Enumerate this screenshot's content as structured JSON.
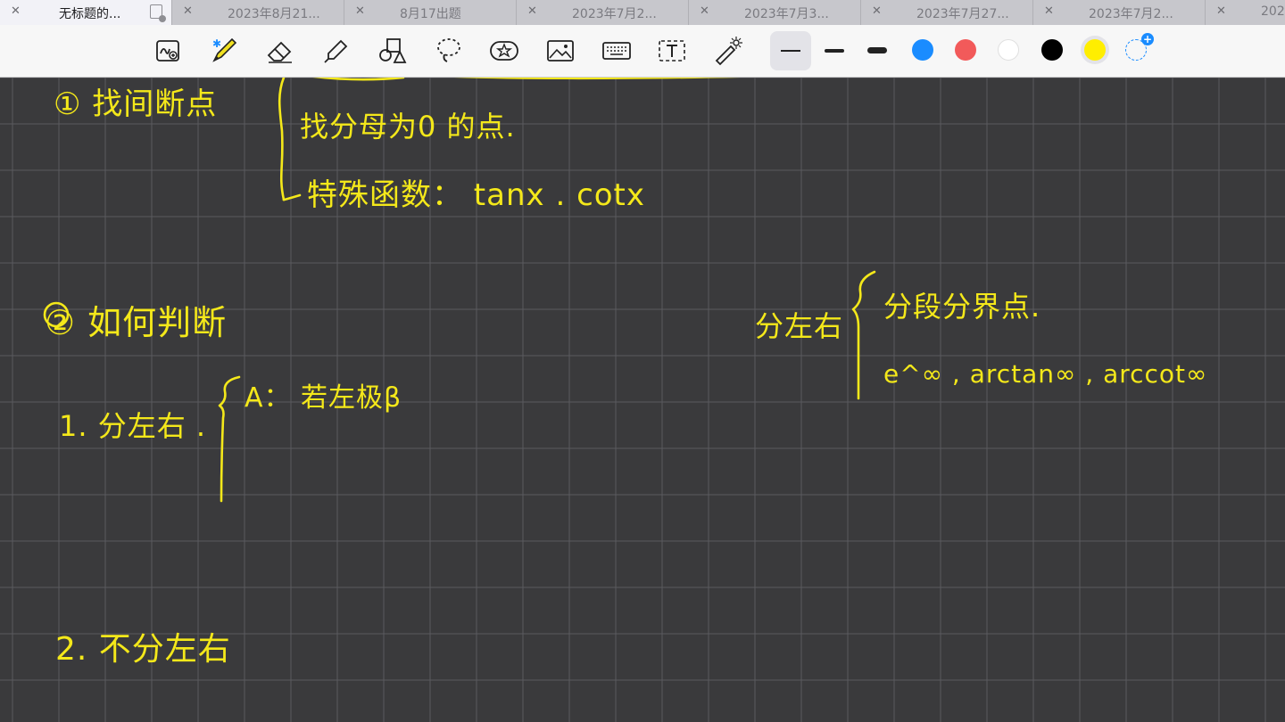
{
  "tabs": [
    {
      "label": "无标题的...",
      "active": true
    },
    {
      "label": "2023年8月21...",
      "active": false
    },
    {
      "label": "8月17出题",
      "active": false
    },
    {
      "label": "2023年7月2...",
      "active": false
    },
    {
      "label": "2023年7月3...",
      "active": false
    },
    {
      "label": "2023年7月27...",
      "active": false
    },
    {
      "label": "2023年7月2...",
      "active": false
    },
    {
      "label": "202",
      "active": false
    }
  ],
  "toolbar": {
    "tools": [
      "handwriting-zoom",
      "pen",
      "eraser",
      "highlighter",
      "shapes",
      "lasso",
      "sticker",
      "image",
      "keyboard",
      "text",
      "laser-pointer"
    ],
    "bluetooth_symbol": "✱",
    "stroke_widths": [
      "thin",
      "medium",
      "thick"
    ],
    "colors": [
      "#1a8cff",
      "#f25a5a",
      "#ffffff",
      "#000000",
      "#ffee00"
    ],
    "selected_color": "#ffee00",
    "add_color_symbol": "+"
  },
  "notes": {
    "line1": "① 找间断点",
    "line2": "找分母为0 的点.",
    "line3": "特殊函数： tanx . cotx",
    "line4": "② 如何判断",
    "line5": "1. 分左右 .",
    "line6": "A： 若左极β",
    "line7": "2. 不分左右",
    "line8": "分左右",
    "line9": "分段分界点.",
    "line10": "e^∞ , arctan∞ , arccot∞"
  },
  "colors": {
    "ink": "#f4e81a",
    "canvas": "#3a3a3c",
    "grid": "#5a5a5e"
  }
}
